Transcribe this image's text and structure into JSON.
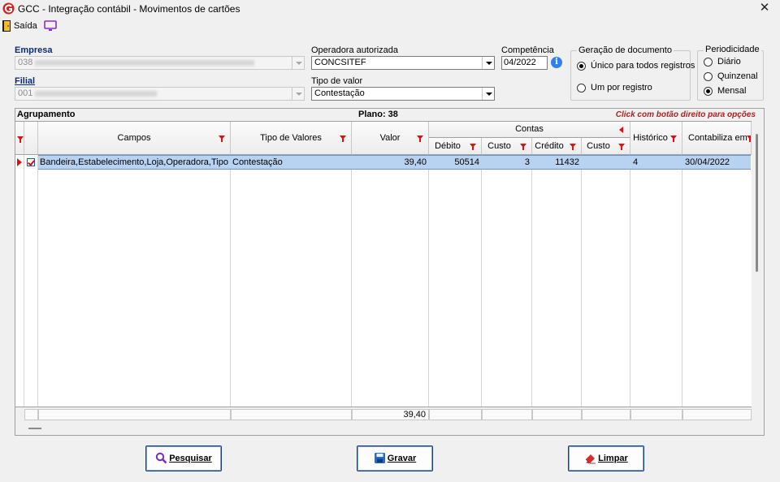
{
  "window": {
    "title": "GCC - Integração contábil - Movimentos de cartões",
    "close": "✕"
  },
  "toolbar": {
    "exit_label": "Saída"
  },
  "form": {
    "empresa_label": "Empresa",
    "empresa_value": "038",
    "filial_label": "Filial",
    "filial_value": "001",
    "operadora_label": "Operadora autorizada",
    "operadora_value": "CONCSITEF",
    "tipo_valor_label": "Tipo de valor",
    "tipo_valor_value": "Contestação",
    "competencia_label": "Competência",
    "competencia_value": "04/2022",
    "info": "i"
  },
  "geracao": {
    "title": "Geração de documento",
    "options": [
      "Único para todos registros",
      "Um por registro"
    ],
    "selected": 0
  },
  "periodicidade": {
    "title": "Periodicidade",
    "options": [
      "Diário",
      "Quinzenal",
      "Mensal"
    ],
    "selected": 2
  },
  "grid": {
    "group_label": "Agrupamento",
    "plano_label": "Plano: 38",
    "hint": "Click com botão direito para opções",
    "headers": {
      "campos": "Campos",
      "tipo_valores": "Tipo de Valores",
      "valor": "Valor",
      "contas": "Contas",
      "debito": "Débito",
      "custo1": "Custo",
      "credito": "Crédito",
      "custo2": "Custo",
      "historico": "Histórico",
      "contabiliza_em": "Contabiliza em"
    },
    "rows": [
      {
        "campos": "Bandeira,Estabelecimento,Loja,Operadora,Tipo",
        "tipo_valores": "Contestação",
        "valor": "39,40",
        "debito": "50514",
        "custo1": "3",
        "credito": "11432",
        "custo2": "",
        "historico": "4",
        "contabiliza_em": "30/04/2022"
      }
    ],
    "total_valor": "39,40"
  },
  "buttons": {
    "pesquisar": "Pesquisar",
    "gravar": "Gravar",
    "limpar": "Limpar"
  }
}
